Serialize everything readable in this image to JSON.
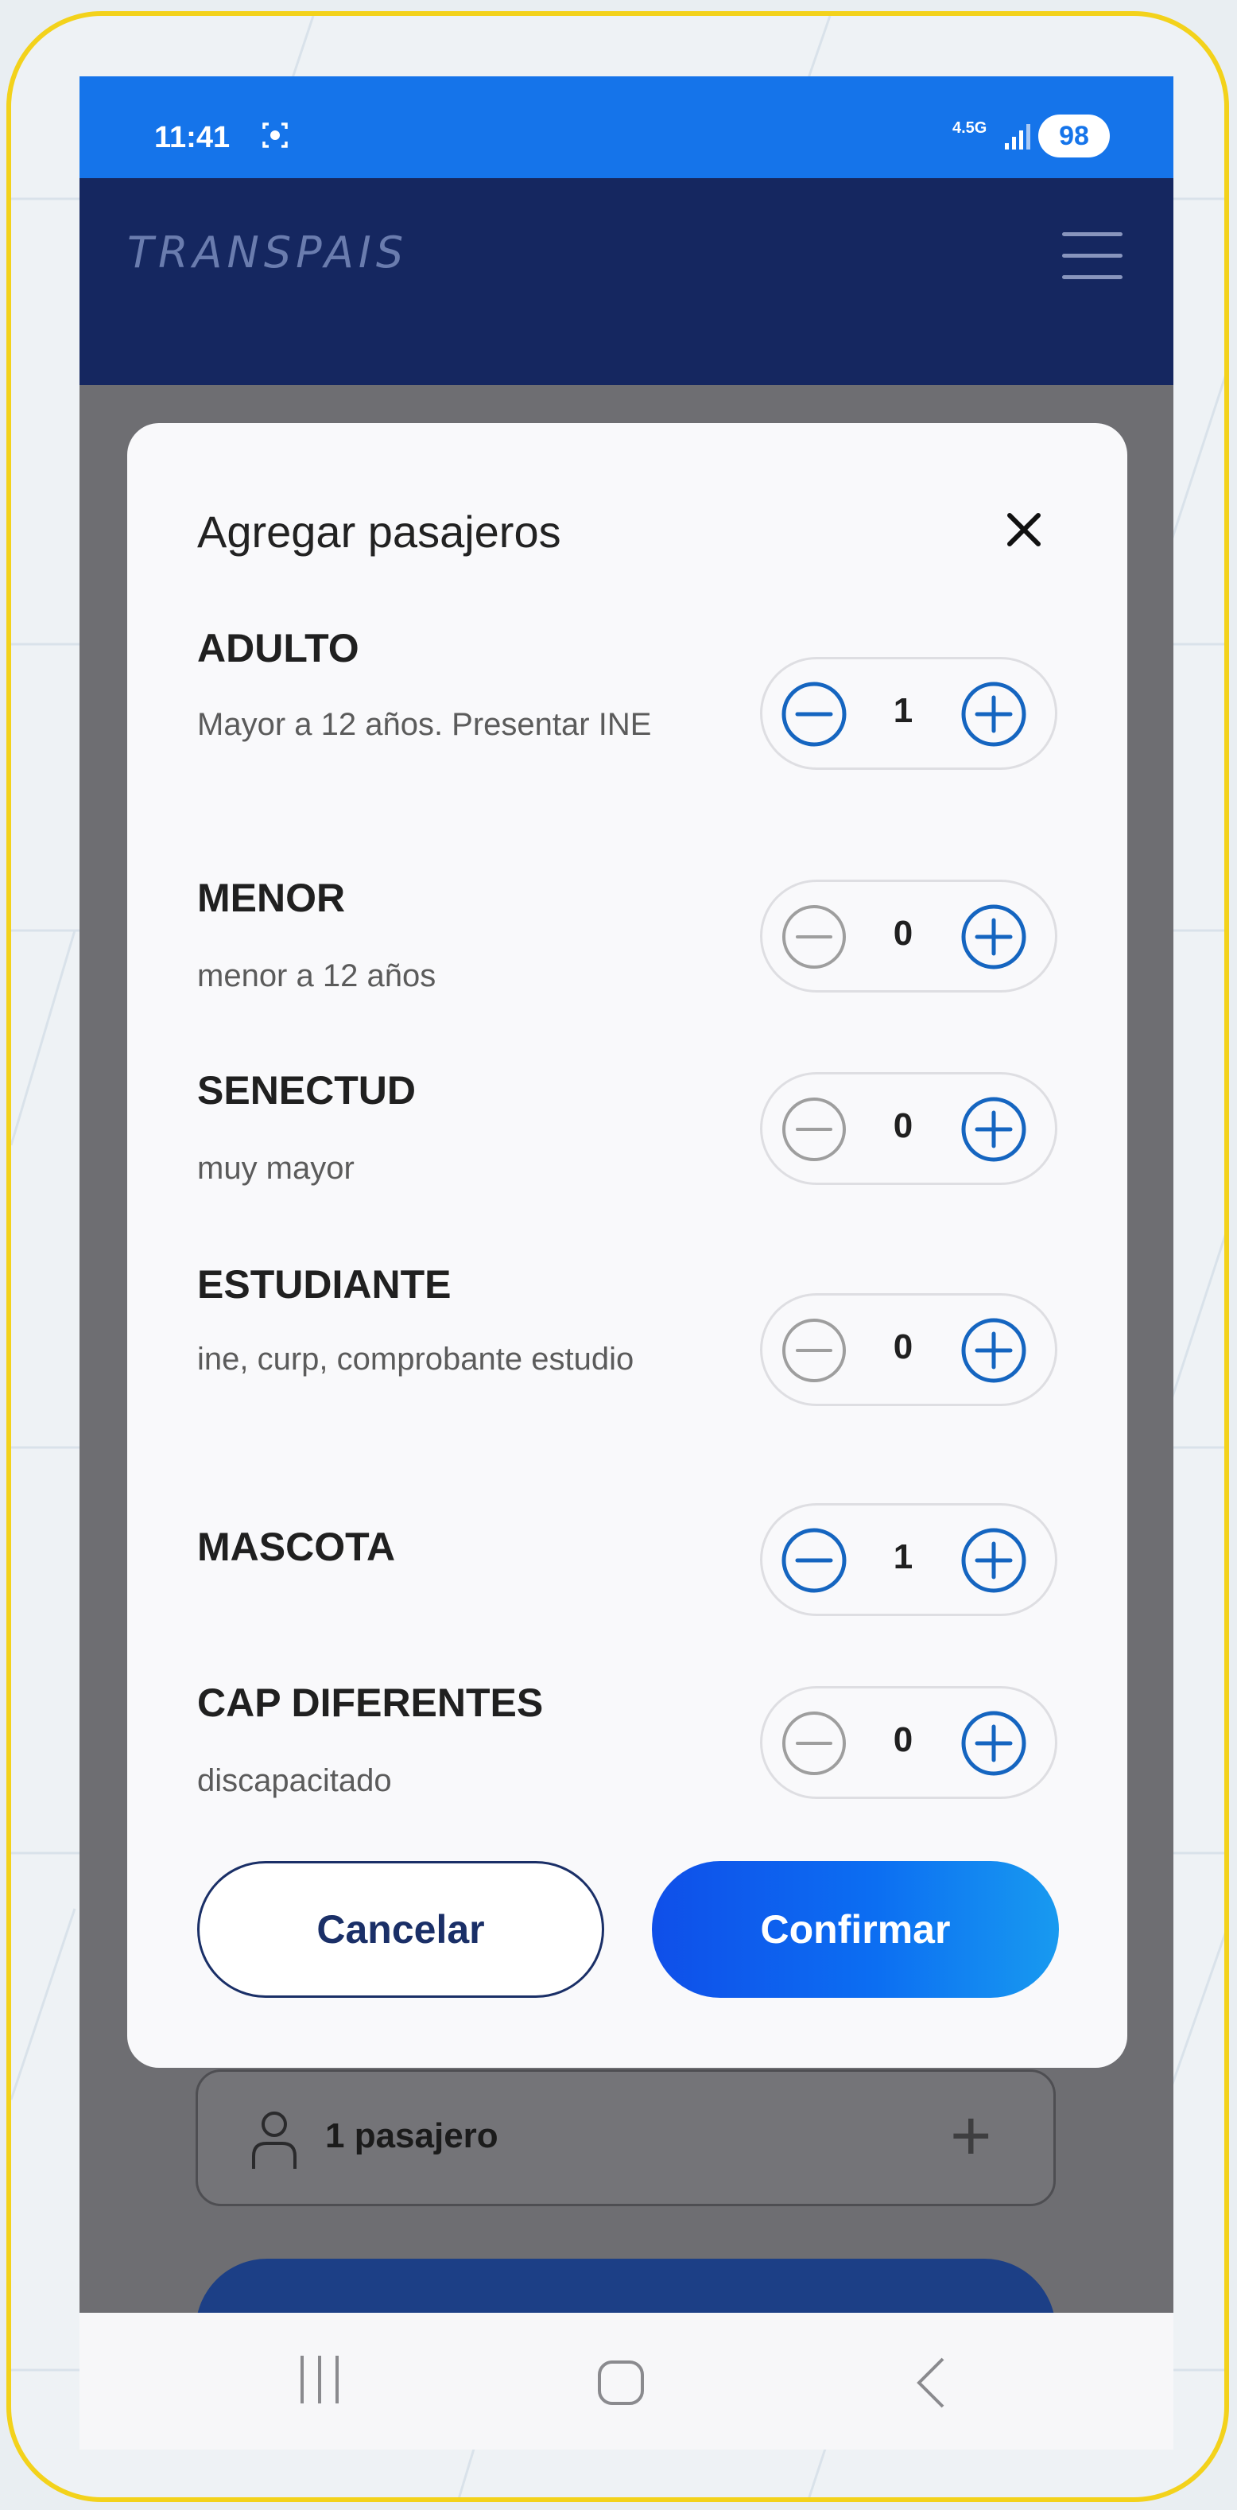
{
  "status_bar": {
    "time": "11:41",
    "network": "4.5G",
    "battery": "98"
  },
  "app_bar": {
    "logo": "TRANSPAIS"
  },
  "modal": {
    "title": "Agregar pasajeros",
    "close_icon": "close-icon",
    "rows": [
      {
        "title": "ADULTO",
        "subtitle": "Mayor a 12 años. Presentar INE",
        "count": "1",
        "minus_enabled": true
      },
      {
        "title": "MENOR",
        "subtitle": "menor a 12 años",
        "count": "0",
        "minus_enabled": false
      },
      {
        "title": "SENECTUD",
        "subtitle": "muy mayor",
        "count": "0",
        "minus_enabled": false
      },
      {
        "title": "ESTUDIANTE",
        "subtitle": "ine, curp, comprobante estudio",
        "count": "0",
        "minus_enabled": false
      },
      {
        "title": "MASCOTA",
        "subtitle": "",
        "count": "1",
        "minus_enabled": true
      },
      {
        "title": "CAP DIFERENTES",
        "subtitle": "discapacitado",
        "count": "0",
        "minus_enabled": false
      }
    ],
    "cancel_label": "Cancelar",
    "confirm_label": "Confirmar"
  },
  "background": {
    "passenger_field": "1 pasajero"
  },
  "colors": {
    "accent_blue": "#1565c0",
    "disabled_gray": "#9e9e9e",
    "status_bar": "#1574ea",
    "app_bar": "#152760",
    "frame": "#f3d21b"
  }
}
